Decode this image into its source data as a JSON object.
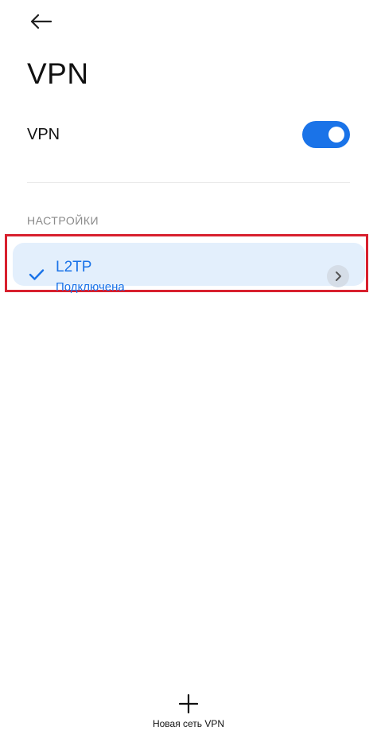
{
  "header": {
    "title": "VPN",
    "back_icon": "back-arrow-icon"
  },
  "vpn_toggle": {
    "label": "VPN",
    "enabled": true,
    "color": "#1a73e8"
  },
  "settings": {
    "section_title": "НАСТРОЙКИ",
    "profiles": [
      {
        "name": "L2TP",
        "status": "Подключена",
        "selected": true,
        "check_icon": "checkmark-icon",
        "detail_icon": "chevron-right-icon"
      }
    ]
  },
  "footer": {
    "add_label": "Новая сеть VPN",
    "add_icon": "plus-icon"
  },
  "colors": {
    "accent": "#1a73e8",
    "card_background": "#e3effc",
    "highlight_border": "#d8202e"
  }
}
